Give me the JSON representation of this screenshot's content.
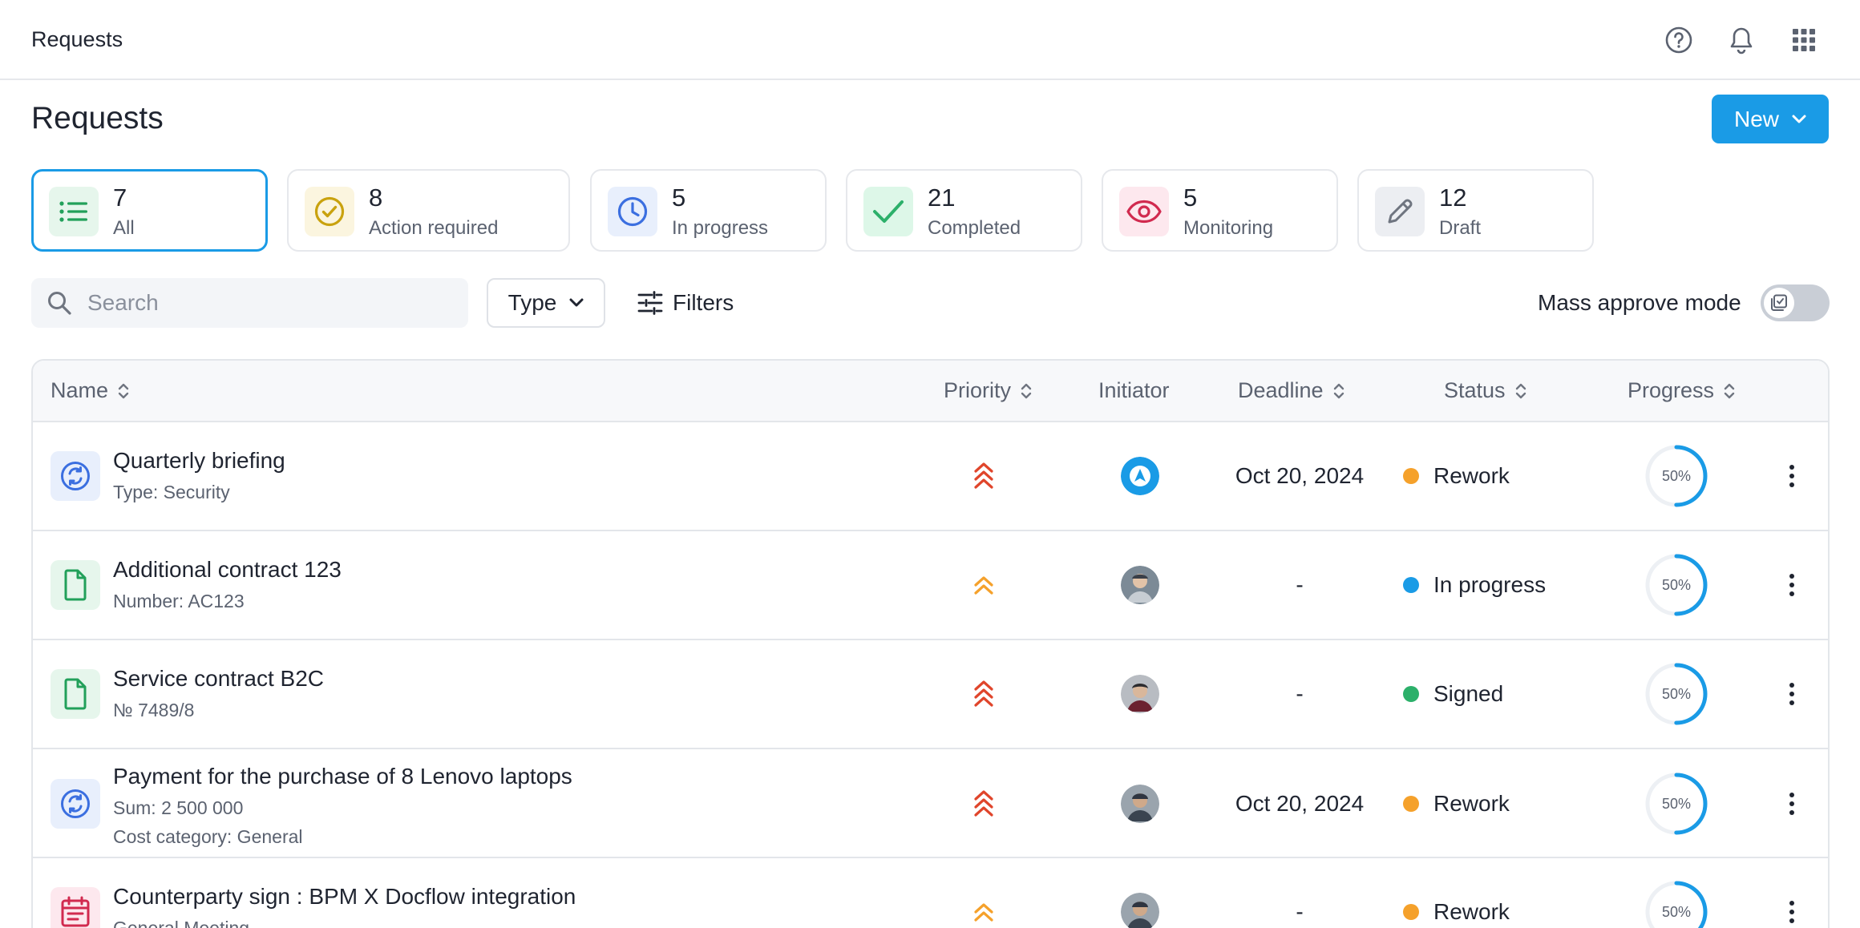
{
  "topbar": {
    "breadcrumb": "Requests",
    "icons": [
      "help-icon",
      "bell-icon",
      "apps-grid-icon"
    ]
  },
  "header": {
    "title": "Requests",
    "new_button": "New"
  },
  "stats": [
    {
      "count": "7",
      "label": "All",
      "icon": "list-icon",
      "color": "#22a05a",
      "active": true
    },
    {
      "count": "8",
      "label": "Action required",
      "icon": "check-circle-icon",
      "color": "#c9a20e",
      "active": false
    },
    {
      "count": "5",
      "label": "In progress",
      "icon": "clock-icon",
      "color": "#3b6fe0",
      "active": false
    },
    {
      "count": "21",
      "label": "Completed",
      "icon": "check-icon",
      "color": "#2cb06a",
      "active": false
    },
    {
      "count": "5",
      "label": "Monitoring",
      "icon": "eye-icon",
      "color": "#d12a4f",
      "active": false
    },
    {
      "count": "12",
      "label": "Draft",
      "icon": "pencil-icon",
      "color": "#6f7580",
      "active": false
    }
  ],
  "toolbar": {
    "search_placeholder": "Search",
    "type_label": "Type",
    "filters_label": "Filters",
    "mass_approve_label": "Mass approve mode",
    "mass_approve_on": false
  },
  "table": {
    "columns": {
      "name": "Name",
      "priority": "Priority",
      "initiator": "Initiator",
      "deadline": "Deadline",
      "status": "Status",
      "progress": "Progress"
    },
    "rows": [
      {
        "title": "Quarterly briefing",
        "subtitles": [
          "Type: Security"
        ],
        "icon": "sync-icon",
        "priority": "high",
        "deadline": "Oct 20, 2024",
        "status": "Rework",
        "status_color": "#f5a12b",
        "progress": "50%",
        "progress_value": 0.5
      },
      {
        "title": "Additional contract 123",
        "subtitles": [
          "Number: AC123"
        ],
        "icon": "document-icon",
        "priority": "medium",
        "deadline": "-",
        "status": "In progress",
        "status_color": "#1a9be6",
        "progress": "50%",
        "progress_value": 0.5
      },
      {
        "title": "Service contract B2C",
        "subtitles": [
          "№ 7489/8"
        ],
        "icon": "document-icon",
        "priority": "high",
        "deadline": "-",
        "status": "Signed",
        "status_color": "#2cb06a",
        "progress": "50%",
        "progress_value": 0.5
      },
      {
        "title": "Payment for the purchase of 8 Lenovo laptops",
        "subtitles": [
          "Sum: 2 500 000",
          "Cost category: General"
        ],
        "icon": "sync-icon",
        "priority": "high",
        "deadline": "Oct 20, 2024",
        "status": "Rework",
        "status_color": "#f5a12b",
        "progress": "50%",
        "progress_value": 0.5
      },
      {
        "title": "Counterparty sign : BPM X Docflow integration",
        "subtitles": [
          "General Meeting"
        ],
        "icon": "calendar-icon",
        "priority": "medium",
        "deadline": "-",
        "status": "Rework",
        "status_color": "#f5a12b",
        "progress": "50%",
        "progress_value": 0.5
      }
    ]
  }
}
